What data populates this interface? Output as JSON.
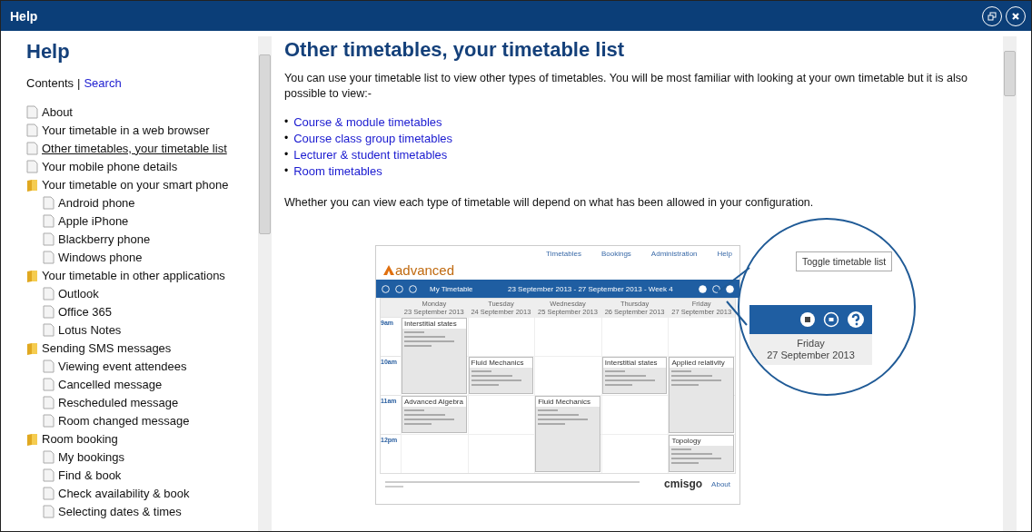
{
  "window": {
    "title": "Help"
  },
  "sidebar": {
    "heading": "Help",
    "contents_label": "Contents",
    "separator": "|",
    "search_link": "Search",
    "tree": [
      {
        "label": "About",
        "kind": "page",
        "selected": false
      },
      {
        "label": "Your timetable in a web browser",
        "kind": "page",
        "selected": false
      },
      {
        "label": "Other timetables, your timetable list",
        "kind": "page",
        "selected": true
      },
      {
        "label": "Your mobile phone details",
        "kind": "page",
        "selected": false
      },
      {
        "label": "Your timetable on your smart phone",
        "kind": "folder",
        "selected": false,
        "children": [
          {
            "label": "Android phone",
            "kind": "page",
            "selected": false
          },
          {
            "label": "Apple iPhone",
            "kind": "page",
            "selected": false
          },
          {
            "label": "Blackberry phone",
            "kind": "page",
            "selected": false
          },
          {
            "label": "Windows phone",
            "kind": "page",
            "selected": false
          }
        ]
      },
      {
        "label": "Your timetable in other applications",
        "kind": "folder",
        "selected": false,
        "children": [
          {
            "label": "Outlook",
            "kind": "page",
            "selected": false
          },
          {
            "label": "Office 365",
            "kind": "page",
            "selected": false
          },
          {
            "label": "Lotus Notes",
            "kind": "page",
            "selected": false
          }
        ]
      },
      {
        "label": "Sending SMS messages",
        "kind": "folder",
        "selected": false,
        "children": [
          {
            "label": "Viewing event attendees",
            "kind": "page",
            "selected": false
          },
          {
            "label": "Cancelled message",
            "kind": "page",
            "selected": false
          },
          {
            "label": "Rescheduled message",
            "kind": "page",
            "selected": false
          },
          {
            "label": "Room changed message",
            "kind": "page",
            "selected": false
          }
        ]
      },
      {
        "label": "Room booking",
        "kind": "folder",
        "selected": false,
        "children": [
          {
            "label": "My bookings",
            "kind": "page",
            "selected": false
          },
          {
            "label": "Find & book",
            "kind": "page",
            "selected": false
          },
          {
            "label": "Check availability & book",
            "kind": "page",
            "selected": false
          },
          {
            "label": "Selecting dates & times",
            "kind": "page",
            "selected": false
          }
        ]
      }
    ]
  },
  "article": {
    "title": "Other timetables, your timetable list",
    "intro": "You can use your timetable list to view other types of timetables. You will be most familiar with looking at your own timetable but it is also possible to view:-",
    "bullet": "•",
    "links": [
      "Course & module timetables",
      "Course class group timetables",
      "Lecturer & student timetables",
      "Room timetables"
    ],
    "outro": "Whether you can view each type of timetable will depend on what has been allowed in your configuration.",
    "figure": {
      "logo": "advanced",
      "nav": [
        "Timetables",
        "Bookings",
        "Administration",
        "Help"
      ],
      "toolbar_title": "My Timetable",
      "date_range": "23 September 2013 - 27 September 2013 - Week 4",
      "days": [
        {
          "name": "Monday",
          "date": "23 September 2013"
        },
        {
          "name": "Tuesday",
          "date": "24 September 2013"
        },
        {
          "name": "Wednesday",
          "date": "25 September 2013"
        },
        {
          "name": "Thursday",
          "date": "26 September 2013"
        },
        {
          "name": "Friday",
          "date": "27 September 2013"
        }
      ],
      "hours": [
        "9am",
        "10am",
        "11am",
        "12pm"
      ],
      "events": [
        {
          "title": "Interstitial states"
        },
        {
          "title": "Advanced Algebra"
        },
        {
          "title": "Fluid Mechanics"
        },
        {
          "title": "Fluid Mechanics"
        },
        {
          "title": "Interstitial states"
        },
        {
          "title": "Applied relativity"
        },
        {
          "title": "Topology"
        }
      ],
      "brand": "cmisgo",
      "about": "About",
      "tooltip": "Toggle timetable list",
      "zoom_day": "Friday",
      "zoom_date": "27 September 2013"
    }
  }
}
